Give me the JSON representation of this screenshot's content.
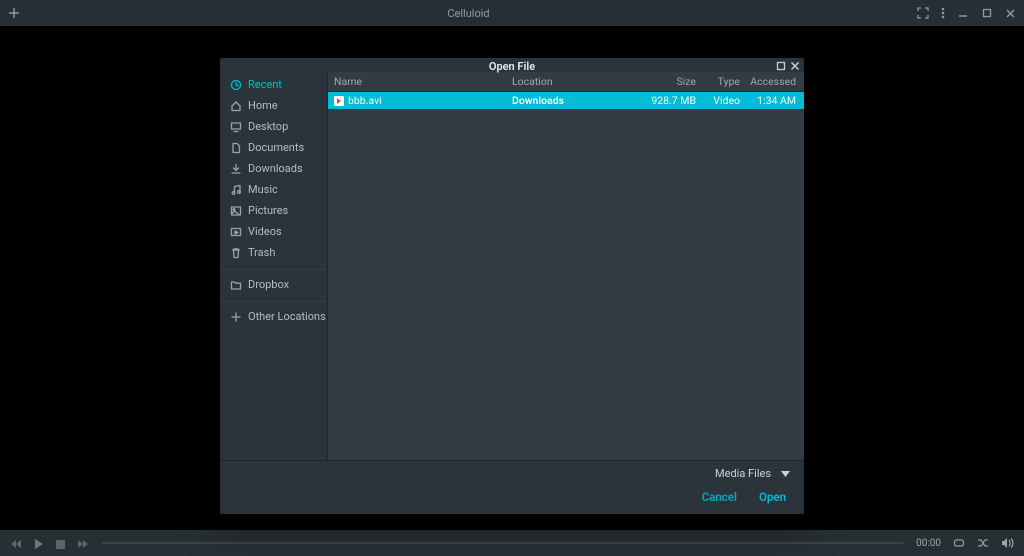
{
  "window": {
    "title": "Celluloid"
  },
  "bottom": {
    "time": "00:00"
  },
  "dialog": {
    "title": "Open File",
    "sidebar": {
      "places": [
        {
          "label": "Recent",
          "icon": "clock",
          "active": true
        },
        {
          "label": "Home",
          "icon": "home",
          "active": false
        },
        {
          "label": "Desktop",
          "icon": "desktop",
          "active": false
        },
        {
          "label": "Documents",
          "icon": "file",
          "active": false
        },
        {
          "label": "Downloads",
          "icon": "download",
          "active": false
        },
        {
          "label": "Music",
          "icon": "music",
          "active": false
        },
        {
          "label": "Pictures",
          "icon": "picture",
          "active": false
        },
        {
          "label": "Videos",
          "icon": "video",
          "active": false
        },
        {
          "label": "Trash",
          "icon": "trash",
          "active": false
        }
      ],
      "mounts": [
        {
          "label": "Dropbox",
          "icon": "folder"
        }
      ],
      "other": [
        {
          "label": "Other Locations",
          "icon": "plus"
        }
      ]
    },
    "columns": {
      "name": "Name",
      "location": "Location",
      "size": "Size",
      "type": "Type",
      "accessed": "Accessed"
    },
    "rows": [
      {
        "name": "bbb.avi",
        "location": "Downloads",
        "size": "928.7 MB",
        "type": "Video",
        "accessed": "1:34 AM"
      }
    ],
    "filter": "Media Files",
    "buttons": {
      "cancel": "Cancel",
      "open": "Open"
    }
  }
}
